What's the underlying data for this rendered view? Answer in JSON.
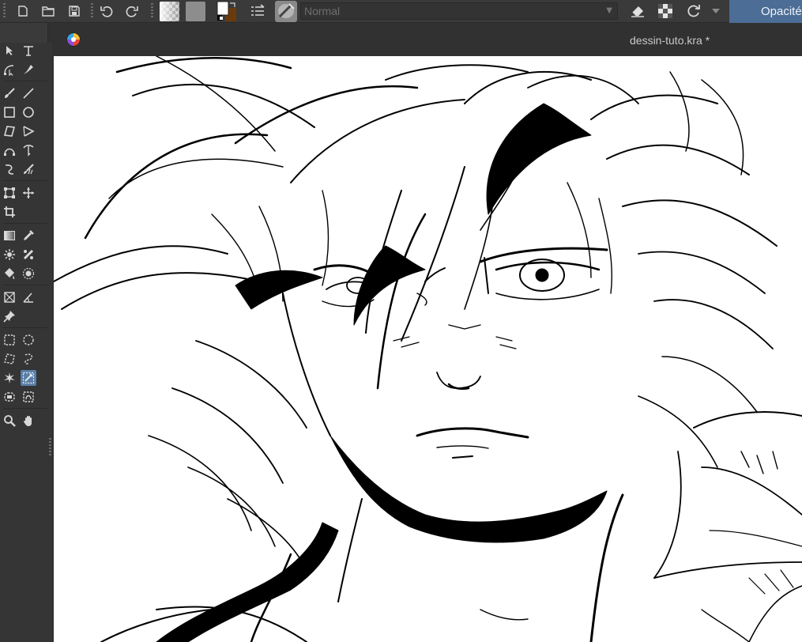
{
  "toolbar": {
    "blend_mode": "Normal",
    "opacity_label": "Opacité",
    "icons": [
      "new-document-icon",
      "open-document-icon",
      "save-icon",
      "undo-icon",
      "redo-icon",
      "gradient-swatch",
      "pattern-swatch",
      "color-swap-icon",
      "brush-presets-icon",
      "brush-preset-thumbnail",
      "eraser-icon",
      "alpha-lock-icon",
      "reload-preset-icon",
      "dropdown-icon"
    ]
  },
  "document": {
    "title": "dessin-tuto.kra *"
  },
  "toolbox": {
    "active_tool": "magnetic-select",
    "tools": [
      "select-shapes",
      "text",
      "edit-shapes",
      "calligraphy",
      "freehand-brush",
      "line",
      "rectangle",
      "ellipse",
      "polygon",
      "polyline",
      "bezier-curve",
      "freehand-path",
      "dynamic-brush",
      "multibrush",
      "transform",
      "move",
      "crop",
      "gradient",
      "color-picker",
      "colorize-mask",
      "smart-patch",
      "fill",
      "enclose-and-fill",
      "assistant",
      "measure",
      "reference-images",
      "rectangular-select",
      "elliptical-select",
      "polygonal-select",
      "freehand-select",
      "contiguous-select",
      "magnetic-select",
      "similar-color-select",
      "bezier-select",
      "zoom",
      "pan"
    ]
  },
  "colors": {
    "accent": "#4b6d96",
    "active_tool_bg": "#5a7fa8",
    "foreground": "#000000",
    "background": "#ffffff",
    "secondary": "#6b3a0a"
  }
}
